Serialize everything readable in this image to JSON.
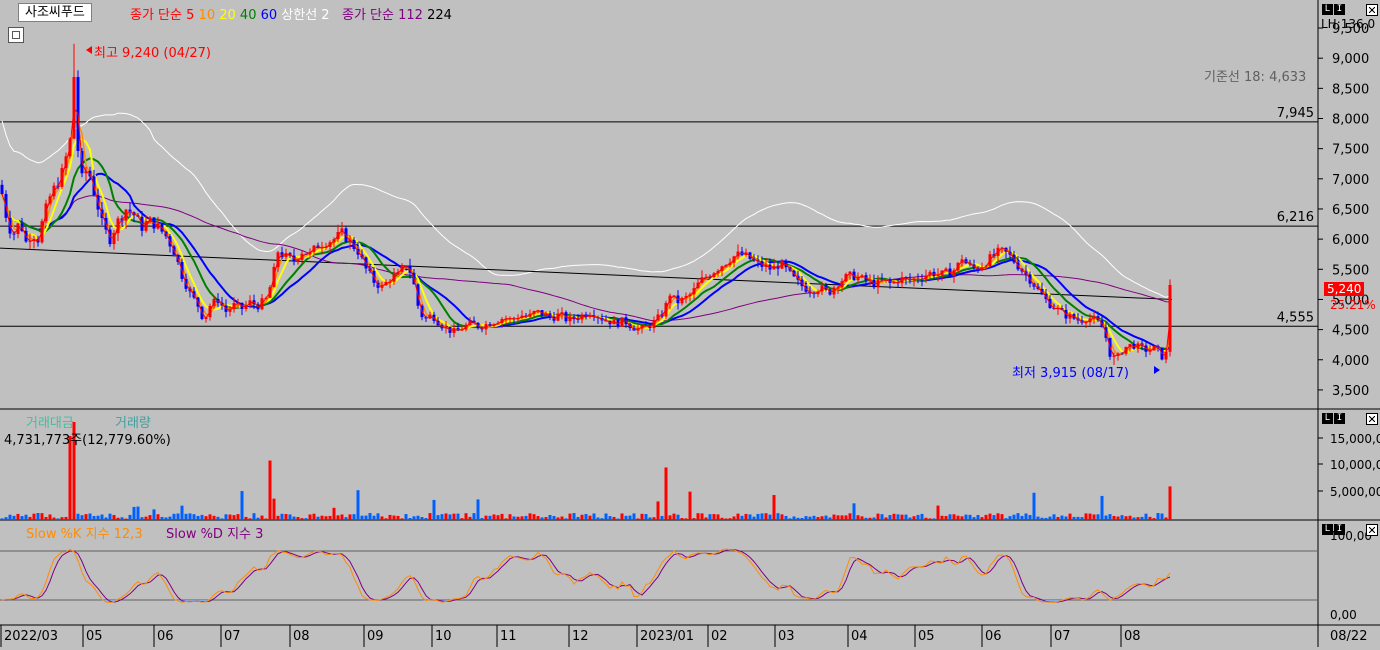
{
  "header": {
    "stock_name": "사조씨푸드",
    "ma_label": "종가 단순",
    "ma_periods": [
      "5",
      "10",
      "20",
      "40",
      "60"
    ],
    "ma_colors": [
      "#ff0000",
      "#ff8c00",
      "#ffff00",
      "#008000",
      "#0000ff"
    ],
    "upper_limit_label": "상한선 2",
    "ma2_label": "종가 단순 112",
    "ma2_extra": "224",
    "price_axis_header": "LH:136,0"
  },
  "annotations": {
    "high_label": "최고 9,240 (04/27)",
    "low_label": "최저 3,915 (08/17)",
    "baseline_label": "기준선 18: 4,633",
    "current_price_badge": "5,240",
    "current_change_pct": "25.21%"
  },
  "volume_panel": {
    "label_amount": "거래대금",
    "label_volume": "거래량",
    "readout": "4,731,773주(12,779.60%)",
    "y_ticks": [
      "15,000,0",
      "10,000,0",
      "5,000,00"
    ]
  },
  "stoch_panel": {
    "label_k": "Slow %K 지수 12,3",
    "label_d": "Slow %D 지수 3",
    "y_ticks": [
      "100,00",
      "0,00"
    ]
  },
  "x_axis": {
    "labels": [
      "2022/03",
      "05",
      "06",
      "07",
      "08",
      "09",
      "10",
      "11",
      "12",
      "2023/01",
      "02",
      "03",
      "04",
      "05",
      "06",
      "07",
      "08"
    ],
    "right_label": "08/22"
  },
  "price_axis": {
    "ticks": [
      "9,500",
      "9,000",
      "8,500",
      "8,000",
      "7,500",
      "7,000",
      "6,500",
      "6,000",
      "5,500",
      "5,000",
      "4,500",
      "4,000",
      "3,500"
    ],
    "hlines": [
      "7,945",
      "6,216",
      "4,555"
    ]
  },
  "chart_data": {
    "type": "candlestick",
    "title": "사조씨푸드",
    "x_range": [
      "2022/03",
      "2023/08/22"
    ],
    "ylim": [
      3200,
      9600
    ],
    "high": {
      "value": 9240,
      "date": "04/27"
    },
    "low": {
      "value": 3915,
      "date": "08/17"
    },
    "last_close": 5240,
    "last_change_pct": 25.21,
    "horizontal_levels": [
      7945,
      6216,
      4555
    ],
    "baseline_18": 4633,
    "close_series": [
      {
        "x": 0,
        "y": 6900
      },
      {
        "x": 4,
        "y": 6600
      },
      {
        "x": 8,
        "y": 6200
      },
      {
        "x": 14,
        "y": 6100
      },
      {
        "x": 20,
        "y": 6300
      },
      {
        "x": 26,
        "y": 5950
      },
      {
        "x": 32,
        "y": 6100
      },
      {
        "x": 38,
        "y": 6000
      },
      {
        "x": 44,
        "y": 6400
      },
      {
        "x": 50,
        "y": 6700
      },
      {
        "x": 56,
        "y": 6900
      },
      {
        "x": 60,
        "y": 7000
      },
      {
        "x": 64,
        "y": 7200
      },
      {
        "x": 68,
        "y": 7500
      },
      {
        "x": 71,
        "y": 7700
      },
      {
        "x": 74,
        "y": 8700
      },
      {
        "x": 77,
        "y": 7600
      },
      {
        "x": 82,
        "y": 7000
      },
      {
        "x": 88,
        "y": 7200
      },
      {
        "x": 92,
        "y": 6900
      },
      {
        "x": 97,
        "y": 6600
      },
      {
        "x": 103,
        "y": 6200
      },
      {
        "x": 110,
        "y": 6000
      },
      {
        "x": 118,
        "y": 6300
      },
      {
        "x": 126,
        "y": 6500
      },
      {
        "x": 134,
        "y": 6400
      },
      {
        "x": 142,
        "y": 6200
      },
      {
        "x": 150,
        "y": 6300
      },
      {
        "x": 158,
        "y": 6200
      },
      {
        "x": 166,
        "y": 6050
      },
      {
        "x": 174,
        "y": 5800
      },
      {
        "x": 182,
        "y": 5400
      },
      {
        "x": 190,
        "y": 5100
      },
      {
        "x": 198,
        "y": 4900
      },
      {
        "x": 204,
        "y": 4650
      },
      {
        "x": 210,
        "y": 4900
      },
      {
        "x": 218,
        "y": 5000
      },
      {
        "x": 226,
        "y": 4800
      },
      {
        "x": 234,
        "y": 4900
      },
      {
        "x": 242,
        "y": 4850
      },
      {
        "x": 250,
        "y": 4950
      },
      {
        "x": 258,
        "y": 4900
      },
      {
        "x": 266,
        "y": 5000
      },
      {
        "x": 272,
        "y": 5300
      },
      {
        "x": 278,
        "y": 5800
      },
      {
        "x": 286,
        "y": 5700
      },
      {
        "x": 294,
        "y": 5650
      },
      {
        "x": 302,
        "y": 5800
      },
      {
        "x": 310,
        "y": 5750
      },
      {
        "x": 318,
        "y": 5900
      },
      {
        "x": 326,
        "y": 5950
      },
      {
        "x": 334,
        "y": 6000
      },
      {
        "x": 342,
        "y": 6100
      },
      {
        "x": 350,
        "y": 5950
      },
      {
        "x": 358,
        "y": 5800
      },
      {
        "x": 366,
        "y": 5500
      },
      {
        "x": 374,
        "y": 5300
      },
      {
        "x": 382,
        "y": 5200
      },
      {
        "x": 390,
        "y": 5350
      },
      {
        "x": 398,
        "y": 5400
      },
      {
        "x": 406,
        "y": 5600
      },
      {
        "x": 412,
        "y": 5400
      },
      {
        "x": 418,
        "y": 4900
      },
      {
        "x": 424,
        "y": 4650
      },
      {
        "x": 432,
        "y": 4750
      },
      {
        "x": 440,
        "y": 4600
      },
      {
        "x": 448,
        "y": 4500
      },
      {
        "x": 456,
        "y": 4450
      },
      {
        "x": 464,
        "y": 4550
      },
      {
        "x": 472,
        "y": 4600
      },
      {
        "x": 480,
        "y": 4550
      },
      {
        "x": 488,
        "y": 4600
      },
      {
        "x": 496,
        "y": 4650
      },
      {
        "x": 504,
        "y": 4700
      },
      {
        "x": 512,
        "y": 4650
      },
      {
        "x": 520,
        "y": 4750
      },
      {
        "x": 528,
        "y": 4700
      },
      {
        "x": 536,
        "y": 4800
      },
      {
        "x": 544,
        "y": 4750
      },
      {
        "x": 552,
        "y": 4700
      },
      {
        "x": 560,
        "y": 4750
      },
      {
        "x": 568,
        "y": 4650
      },
      {
        "x": 576,
        "y": 4700
      },
      {
        "x": 584,
        "y": 4750
      },
      {
        "x": 592,
        "y": 4800
      },
      {
        "x": 600,
        "y": 4700
      },
      {
        "x": 608,
        "y": 4650
      },
      {
        "x": 616,
        "y": 4600
      },
      {
        "x": 624,
        "y": 4650
      },
      {
        "x": 632,
        "y": 4550
      },
      {
        "x": 640,
        "y": 4500
      },
      {
        "x": 648,
        "y": 4550
      },
      {
        "x": 656,
        "y": 4650
      },
      {
        "x": 664,
        "y": 4800
      },
      {
        "x": 670,
        "y": 5100
      },
      {
        "x": 676,
        "y": 4950
      },
      {
        "x": 684,
        "y": 5000
      },
      {
        "x": 692,
        "y": 5100
      },
      {
        "x": 700,
        "y": 5300
      },
      {
        "x": 708,
        "y": 5400
      },
      {
        "x": 716,
        "y": 5500
      },
      {
        "x": 724,
        "y": 5600
      },
      {
        "x": 732,
        "y": 5700
      },
      {
        "x": 740,
        "y": 5750
      },
      {
        "x": 748,
        "y": 5700
      },
      {
        "x": 756,
        "y": 5600
      },
      {
        "x": 764,
        "y": 5550
      },
      {
        "x": 772,
        "y": 5500
      },
      {
        "x": 780,
        "y": 5600
      },
      {
        "x": 788,
        "y": 5450
      },
      {
        "x": 796,
        "y": 5300
      },
      {
        "x": 804,
        "y": 5200
      },
      {
        "x": 812,
        "y": 5150
      },
      {
        "x": 820,
        "y": 5200
      },
      {
        "x": 828,
        "y": 5100
      },
      {
        "x": 836,
        "y": 5250
      },
      {
        "x": 844,
        "y": 5350
      },
      {
        "x": 852,
        "y": 5400
      },
      {
        "x": 860,
        "y": 5350
      },
      {
        "x": 868,
        "y": 5300
      },
      {
        "x": 876,
        "y": 5250
      },
      {
        "x": 884,
        "y": 5300
      },
      {
        "x": 892,
        "y": 5250
      },
      {
        "x": 900,
        "y": 5350
      },
      {
        "x": 908,
        "y": 5300
      },
      {
        "x": 916,
        "y": 5350
      },
      {
        "x": 924,
        "y": 5400
      },
      {
        "x": 932,
        "y": 5450
      },
      {
        "x": 940,
        "y": 5400
      },
      {
        "x": 948,
        "y": 5450
      },
      {
        "x": 956,
        "y": 5500
      },
      {
        "x": 962,
        "y": 5700
      },
      {
        "x": 968,
        "y": 5550
      },
      {
        "x": 976,
        "y": 5500
      },
      {
        "x": 984,
        "y": 5600
      },
      {
        "x": 992,
        "y": 5700
      },
      {
        "x": 1000,
        "y": 5800
      },
      {
        "x": 1008,
        "y": 5750
      },
      {
        "x": 1016,
        "y": 5600
      },
      {
        "x": 1024,
        "y": 5450
      },
      {
        "x": 1032,
        "y": 5300
      },
      {
        "x": 1040,
        "y": 5100
      },
      {
        "x": 1048,
        "y": 4950
      },
      {
        "x": 1056,
        "y": 4850
      },
      {
        "x": 1064,
        "y": 4750
      },
      {
        "x": 1072,
        "y": 4700
      },
      {
        "x": 1080,
        "y": 4650
      },
      {
        "x": 1088,
        "y": 4700
      },
      {
        "x": 1096,
        "y": 4650
      },
      {
        "x": 1104,
        "y": 4500
      },
      {
        "x": 1110,
        "y": 4100
      },
      {
        "x": 1116,
        "y": 4000
      },
      {
        "x": 1124,
        "y": 4200
      },
      {
        "x": 1132,
        "y": 4250
      },
      {
        "x": 1140,
        "y": 4200
      },
      {
        "x": 1148,
        "y": 4150
      },
      {
        "x": 1156,
        "y": 4200
      },
      {
        "x": 1162,
        "y": 4050
      },
      {
        "x": 1166,
        "y": 4100
      },
      {
        "x": 1172,
        "y": 5240
      }
    ]
  }
}
